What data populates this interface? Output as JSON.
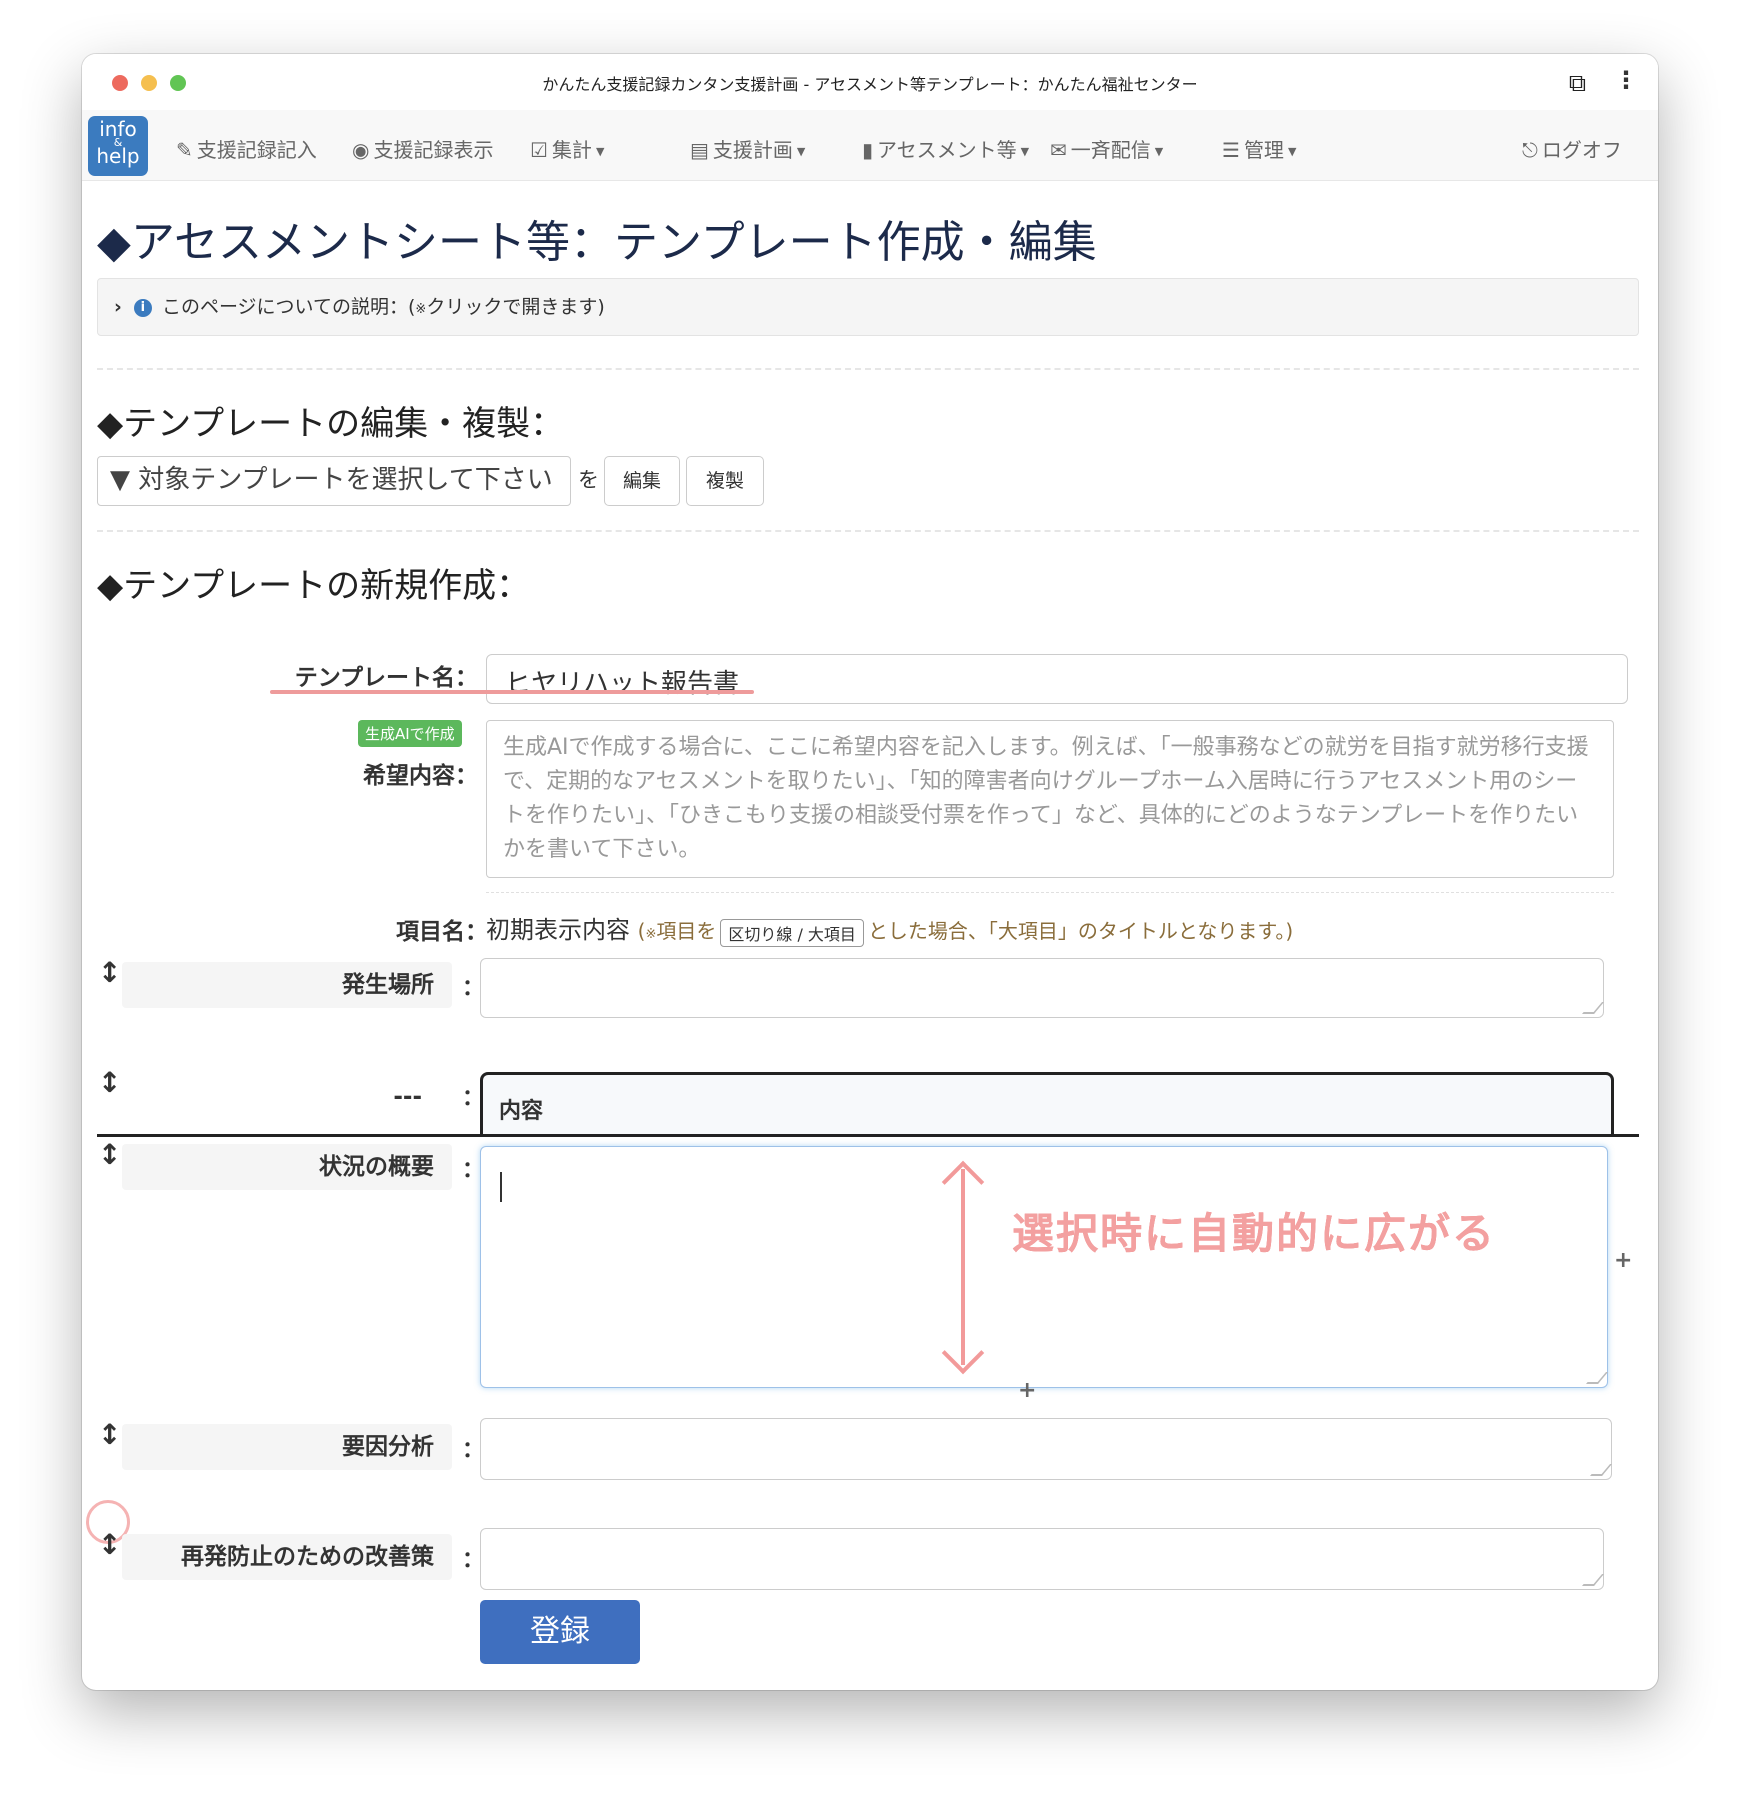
{
  "window": {
    "title": "かんたん支援記録カンタン支援計画 - アセスメント等テンプレート：かんたん福祉センター",
    "extension_icon": "puzzle-icon",
    "more_icon": "more-vertical-icon"
  },
  "navbar": {
    "logo_top": "info",
    "logo_mid": "&",
    "logo_bottom": "help",
    "items": [
      {
        "icon": "✎",
        "label": "支援記録記入"
      },
      {
        "icon": "◉",
        "label": "支援記録表示"
      },
      {
        "icon": "☑",
        "label": "集計"
      },
      {
        "icon": "▤",
        "label": "支援計画"
      },
      {
        "icon": "▮",
        "label": "アセスメント等"
      },
      {
        "icon": "✉",
        "label": "一斉配信"
      },
      {
        "icon": "☰",
        "label": "管理"
      }
    ],
    "logout_icon": "⎋",
    "logout_label": "ログオフ"
  },
  "page": {
    "tag_icon": "◆",
    "title": "アセスメントシート等：テンプレート作成・編集",
    "info_chevron": "›",
    "info_icon": "i",
    "info_text": "このページについての説明：(",
    "info_note_mark": "※",
    "info_text2": "クリックで開きます)"
  },
  "edit_section": {
    "heading": "テンプレートの編集・複製：",
    "select_value": "▼ 対象テンプレートを選択して下さい",
    "wo": "を",
    "edit_button": "編集",
    "copy_button": "複製"
  },
  "new_section": {
    "heading": "テンプレートの新規作成：",
    "name_label": "テンプレート名：",
    "name_value": "ヒヤリハット報告書",
    "ai_badge": "生成AIで作成",
    "wish_label": "希望内容：",
    "wish_placeholder": "生成AIで作成する場合に、ここに希望内容を記入します。例えば、「一般事務などの就労を目指す就労移行支援で、定期的なアセスメントを取りたい」、「知的障害者向けグループホーム入居時に行うアセスメント用のシートを作りたい」、「ひきこもり支援の相談受付票を作って」など、具体的にどのようなテンプレートを作りたいかを書いて下さい。",
    "item_header_label": "項目名：",
    "item_header_text": "初期表示内容",
    "note_open": "(",
    "note_mark": "※",
    "note_a": "項目を",
    "note_kbd": "区切り線 / 大項目",
    "note_b": "とした場合、「大項目」のタイトルとなります。)",
    "rows": [
      {
        "label": "発生場所",
        "value": ""
      },
      {
        "label": "---",
        "value": "内容"
      },
      {
        "label": "状況の概要",
        "value": ""
      },
      {
        "label": "要因分析",
        "value": ""
      },
      {
        "label": "再発防止のための改善策",
        "value": ""
      }
    ],
    "drag_icon": "↕",
    "colon": "：",
    "plus": "+",
    "annotation": "選択時に自動的に広がる",
    "submit": "登録"
  }
}
